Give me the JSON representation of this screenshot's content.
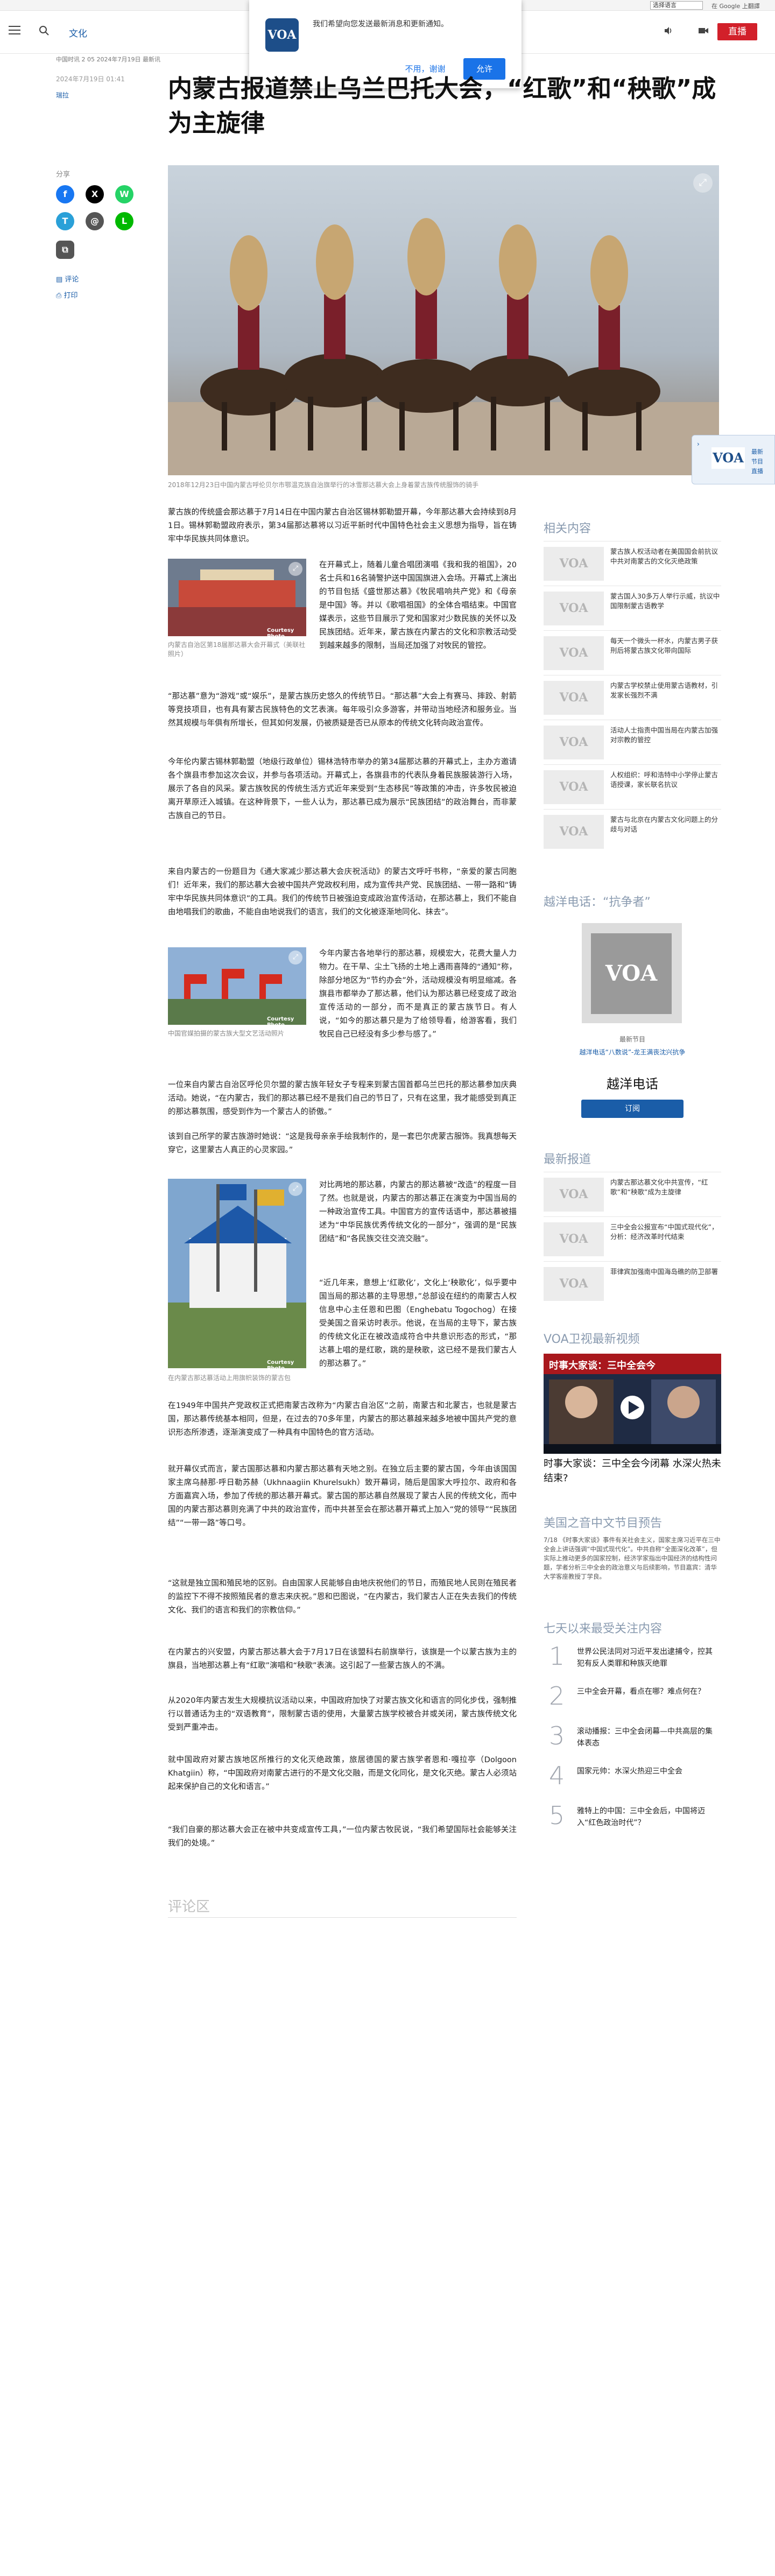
{
  "topbar": {
    "language_select": "选择语言",
    "accessibility": "G",
    "google_translate": "在 Google 上翻譯"
  },
  "header": {
    "section": "文化",
    "live_label": "直播"
  },
  "notification": {
    "text": "我们希望向您发送最新消息和更新通知。",
    "no_label": "不用，谢谢",
    "yes_label": "允许",
    "logo_text": "VOA"
  },
  "article_meta": {
    "breadcrumb": "中国时讯 2 05 2024年7月19日 最新讯",
    "date": "2024年7月19日 01:41",
    "byline": "瑞拉"
  },
  "article": {
    "title": "内蒙古报道禁止乌兰巴托大会，“红歌”和“秧歌”成为主旋律",
    "hero_caption": "2018年12月23日中国内蒙古呼伦贝尔市鄂温克族自治旗举行的冰雪那达慕大会上身着蒙古族传统服饰的骑手",
    "figure1_caption": "内蒙古自治区第18届那达慕大会开幕式（美联社照片）",
    "figure2_caption": "中国官媒拍摄的蒙古族大型文艺活动照片",
    "figure3_caption": "在内蒙古那达慕活动上用旗帜装饰的蒙古包",
    "credit": "Courtesy Photo",
    "paragraphs": [
      "蒙古族的传统盛会那达慕于7月14日在中国内蒙古自治区锡林郭勒盟开幕，今年那达慕大会持续到8月1日。锡林郭勒盟政府表示，第34届那达慕将以习近平新时代中国特色社会主义思想为指导，旨在铸牢中华民族共同体意识。",
      "在开幕式上，随着儿童合唱团演唱《我和我的祖国》，20名士兵和16名骑警护送中国国旗进入会场。开幕式上演出的节目包括《盛世那达慕》《牧民唱响共产党》和《母亲是中国》等。并以《歌唱祖国》的全体合唱结束。中国官媒表示，这些节目展示了党和国家对少数民族的关怀以及民族团结。近年来，蒙古族在内蒙古的文化和宗教活动受到越来越多的限制，当局还加强了对牧民的管控。",
      "“那达慕”意为“游戏”或“娱乐”，是蒙古族历史悠久的传统节日。“那达慕”大会上有赛马、摔跤、射箭等竞技项目，也有具有蒙古民族特色的文艺表演。每年吸引众多游客，并带动当地经济和服务业。当然其规模与年俱有所增长，但其如何发展，仍被质疑是否已从原本的传统文化转向政治宣传。",
      "今年伦内蒙古锡林郭勒盟（地级行政单位）锡林浩特市举办的第34届那达慕的开幕式上，主办方邀请各个旗县市参加这次会议，并参与各项活动。开幕式上，各旗县市的代表队身着民族服装游行入场，展示了各自的风采。蒙古族牧民的传统生活方式近年来受到“生态移民”等政策的冲击，许多牧民被迫离开草原迁入城镇。在这种背景下，一些人认为，那达慕已成为展示“民族团结”的政治舞台，而非蒙古族自己的节日。",
      "来自内蒙古的一份题目为《通大家减少那达慕大会庆祝活动》的蒙古文呼吁书称，“亲爱的蒙古同胞们！近年来，我们的那达慕大会被中国共产党政权利用，成为宣传共产党、民族团结、一带一路和“铸牢中华民族共同体意识”的工具。我们的传统节日被强迫变成政治宣传活动，在那达慕上，我们不能自由地唱我们的歌曲，不能自由地说我们的语言，我们的文化被逐渐地同化、抹去”。",
      "今年内蒙古各地举行的那达慕，规模宏大，花费大量人力物力。在干旱、尘土飞扬的土地上遇雨喜降的“通知”称，除部分地区为“节约办会”外，活动规模没有明显缩减。各旗县市都举办了那达慕，他们认为那达慕已经变成了政治宣传活动的一部分，而不是真正的蒙古族节日。有人说，“如今的那达慕只是为了给领导看，给游客看，我们牧民自己已经没有多少参与感了。”",
      "一位来自内蒙古自治区呼伦贝尔盟的蒙古族年轻女子专程来到蒙古国首都乌兰巴托的那达慕参加庆典活动。她说，“在内蒙古，我们的那达慕已经不是我们自己的节日了，只有在这里，我才能感受到真正的那达慕氛围，感受到作为一个蒙古人的骄傲。”",
      "该到自己所学的蒙古族游时她说：“这是我母亲亲手绘我制作的，是一套巴尔虎蒙古服饰。我真想每天穿它，这里蒙古人真正的心灵家园。”",
      "对比两地的那达慕，内蒙古的那达慕被“改造”的程度一目了然。也就是说，内蒙古的那达慕正在演变为中国当局的一种政治宣传工具。中国官方的宣传话语中，那达慕被描述为“中华民族优秀传统文化的一部分”，强调的是“民族团结”和“各民族交往交流交融”。",
      "“近几年来，意想上‘红歌化’，文化上‘秧歌化’，似乎要中国当局的那达慕的主导思想，”总部设在纽约的南蒙古人权信息中心主任恩和巴图（Enghebatu Togochog）在接受美国之音采访时表示。他说，在当局的主导下，蒙古族的传统文化正在被改造成符合中共意识形态的形式，“那达慕上唱的是红歌，跳的是秧歌，这已经不是我们蒙古人的那达慕了。”",
      "在1949年中国共产党政权正式把南蒙古改称为“内蒙古自治区”之前，南蒙古和北蒙古，也就是蒙古国，那达慕传统基本相同，但是，在过去的70多年里，内蒙古的那达慕越来越多地被中国共产党的意识形态所渗透，逐渐演变成了一种具有中国特色的官方活动。",
      "就开幕仪式而言，蒙古国那达慕和内蒙古那达慕有天地之别。在独立后主要的蒙古国，今年由该国国家主席乌赫那·呼日勒苏赫（Ukhnaagiin Khurelsukh）致开幕词，随后是国家大呼拉尔、政府和各方面嘉宾入场，参加了传统的那达慕开幕式。蒙古国的那达慕自然展现了蒙古人民的传统文化，而中国的内蒙古那达慕则充满了中共的政治宣传，而中共甚至会在那达慕开幕式上加入“党的领导”“民族团结”“一带一路”等口号。",
      "“这就是独立国和殖民地的区别。自由国家人民能够自由地庆祝他们的节日，而殖民地人民则在殖民者的监控下不得不按照殖民者的意志来庆祝。”恩和巴图说，“在内蒙古，我们蒙古人正在失去我们的传统文化、我们的语言和我们的宗教信仰。”",
      "在内蒙古的兴安盟，内蒙古那达慕大会于7月17日在该盟科右前旗举行，该旗是一个以蒙古族为主的旗县，当地那达慕上有“红歌”演唱和“秧歌”表演。这引起了一些蒙古族人的不满。",
      "从2020年内蒙古发生大规模抗议活动以来，中国政府加快了对蒙古族文化和语言的同化步伐，强制推行以普通话为主的“双语教育”，限制蒙古语的使用，大量蒙古族学校被合并或关闭，蒙古族传统文化受到严重冲击。",
      "就中国政府对蒙古族地区所推行的文化灭绝政策，旅居德国的蒙古族学者恩和·嘎拉亭（Dolgoon Khatgiin）称，“中国政府对南蒙古进行的不是文化交融，而是文化同化，是文化灭绝。蒙古人必须站起来保护自己的文化和语言。”",
      "“我们自豪的那达慕大会正在被中共变成宣传工具，”一位内蒙古牧民说，“我们希望国际社会能够关注我们的处境。”"
    ]
  },
  "share": {
    "label": "分享",
    "fb": "f",
    "x": "X",
    "wa": "W",
    "tg": "T",
    "mail": "@",
    "line": "L",
    "copy": "⧉",
    "comments": "评论",
    "print": "打印"
  },
  "comments_section": {
    "title": "评论区"
  },
  "side_widget": {
    "logo": "VOA",
    "line1": "最新",
    "line2": "节目",
    "line3": "直播"
  },
  "related": {
    "title": "相关内容",
    "logo": "VOA",
    "items": [
      "蒙古族人权活动者在美国国会前抗议中共对南蒙古的文化灭绝政策",
      "蒙古国人30多万人举行示威，抗议中国限制蒙古语教学",
      "每天一个微头一杯水，内蒙古男子获刑后将蒙古族文化带向国际",
      "内蒙古学校禁止使用蒙古语教材，引发家长强烈不满",
      "活动人士指责中国当局在内蒙古加强对宗教的管控",
      "人权组织：呼和浩特中小学停止蒙古语授课，家长联名抗议",
      "蒙古与北京在内蒙古文化问题上的分歧与对话"
    ]
  },
  "hotline": {
    "title": "越洋电话：“抗争者”",
    "logo": "VOA",
    "label": "最新节目",
    "sub": "越洋电话“八数说”-龙王满丧沈兴抗争",
    "name": "越洋电话",
    "subscribe": "订阅"
  },
  "latest": {
    "title": "最新报道",
    "logo": "VOA",
    "items": [
      "内蒙古那达慕文化中共宣传，“红歌”和“秧歌”成为主旋律",
      "三中全会公报宣布“中国式现代化”，分析：经济改革时代结束",
      "菲律宾加强南中国海岛礁的防卫部署"
    ]
  },
  "video": {
    "title_section": "VOA卫视最新视频",
    "overlay": "时事大家谈：三中全会今",
    "title": "时事大家谈：三中全会今闭幕 水深火热未结束?"
  },
  "schedule": {
    "title": "美国之音中文节目预告",
    "text": "7/18 《时事大家谈》事件有关社会主义，国家主席习近平在三中全会上讲话强调“中国式现代化”。中共自称“全面深化改革”，但实际上推动更多的国家控制，经济学家指出中国经济的结构性问题，学者分析三中全会的政治意义与后续影响，节目嘉宾：清华大学客座教授丁学良。"
  },
  "popular": {
    "title": "七天以来最受关注内容",
    "items": [
      {
        "num": "1",
        "text": "世界公民法同对习近平发出逮捕令，控其犯有反人类罪和种族灭绝罪"
      },
      {
        "num": "2",
        "text": "三中全会开幕，看点在哪？难点何在？"
      },
      {
        "num": "3",
        "text": "滚动播报：三中全会闭幕—中共高层的集体表态"
      },
      {
        "num": "4",
        "text": "国家元帅：水深火热迎三中全会"
      },
      {
        "num": "5",
        "text": "雅特上的中国：三中全会后，中国将迈入“红色政治时代”？"
      }
    ]
  }
}
